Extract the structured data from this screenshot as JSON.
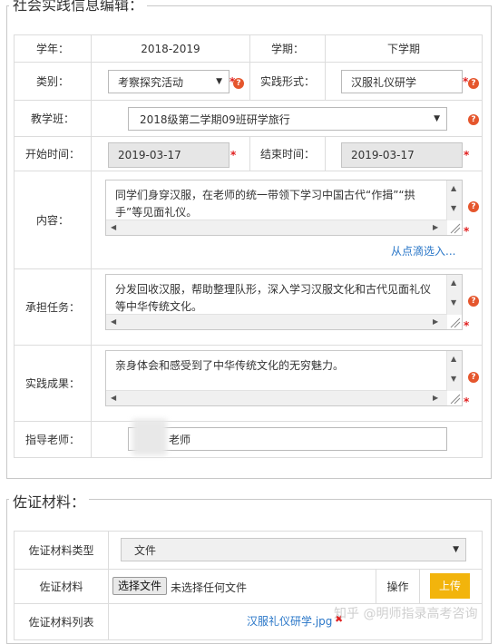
{
  "edit_section": {
    "legend": "社会实践信息编辑：",
    "school_year_label": "学年：",
    "school_year_value": "2018-2019",
    "semester_label": "学期：",
    "semester_value": "下学期",
    "category_label": "类别：",
    "category_value": "考察探究活动",
    "form_label": "实践形式：",
    "form_value": "汉服礼仪研学",
    "class_label": "教学班：",
    "class_value": "2018级第二学期09班研学旅行",
    "start_label": "开始时间：",
    "start_value": "2019-03-17",
    "end_label": "结束时间：",
    "end_value": "2019-03-17",
    "content_label": "内容：",
    "content_text": "同学们身穿汉服，在老师的统一带领下学习中国古代“作揖”“拱手”等见面礼仪。",
    "select_link": "从点滴选入...",
    "task_label": "承担任务：",
    "task_text": "分发回收汉服，帮助整理队形，深入学习汉服文化和古代见面礼仪等中华传统文化。",
    "result_label": "实践成果：",
    "result_text": "亲身体会和感受到了中华传统文化的无穷魅力。",
    "teacher_label": "指导老师：",
    "teacher_value": "老师",
    "required_mark": "*",
    "help_mark": "?"
  },
  "evidence_section": {
    "legend": "佐证材料：",
    "type_label": "佐证材料类型",
    "type_value": "文件",
    "file_label": "佐证材料",
    "choose_file_button": "选择文件",
    "no_file_text": "未选择任何文件",
    "operation_label": "操作",
    "upload_button": "上传",
    "list_label": "佐证材料列表",
    "file_name": "汉服礼仪研学.jpg",
    "delete_mark": "✖"
  },
  "watermark": "知乎 @明师指录高考咨询",
  "colors": {
    "required": "#e02020",
    "help": "#e5562d",
    "link": "#2a77c8",
    "upload": "#f2b40c"
  }
}
